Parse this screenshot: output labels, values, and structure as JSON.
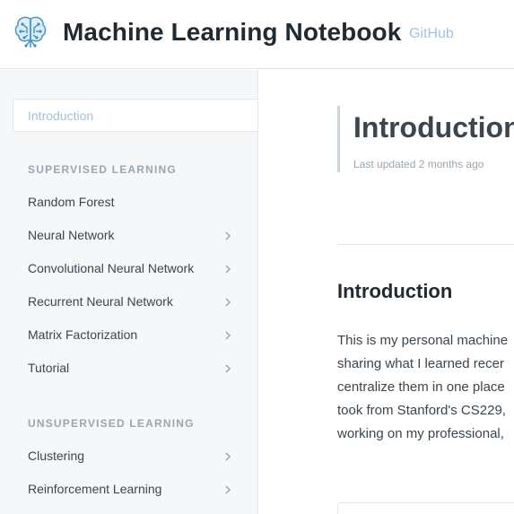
{
  "header": {
    "logo_icon": "brain-circuit-icon",
    "title": "Machine Learning Notebook",
    "nav_link": "GitHub"
  },
  "sidebar": {
    "active_item": "Introduction",
    "sections": [
      {
        "title": "SUPERVISED LEARNING",
        "items": [
          {
            "label": "Random Forest",
            "has_children": false
          },
          {
            "label": "Neural Network",
            "has_children": true
          },
          {
            "label": "Convolutional Neural Network",
            "has_children": true
          },
          {
            "label": "Recurrent Neural Network",
            "has_children": true
          },
          {
            "label": "Matrix Factorization",
            "has_children": true
          },
          {
            "label": "Tutorial",
            "has_children": true
          }
        ]
      },
      {
        "title": "UNSUPERVISED LEARNING",
        "items": [
          {
            "label": "Clustering",
            "has_children": true
          },
          {
            "label": "Reinforcement Learning",
            "has_children": true
          }
        ]
      }
    ]
  },
  "main": {
    "page_title": "Introduction",
    "last_updated": "Last updated 2 months ago",
    "heading": "Introduction",
    "paragraph_lines": [
      "This is my personal machine",
      "sharing what I learned recer",
      "centralize them in one place",
      "took from Stanford's CS229,",
      "working on my professional,"
    ]
  },
  "colors": {
    "accent": "#9fc3dd",
    "text": "#3b454e",
    "sidebar_bg": "#f5f7f9"
  }
}
